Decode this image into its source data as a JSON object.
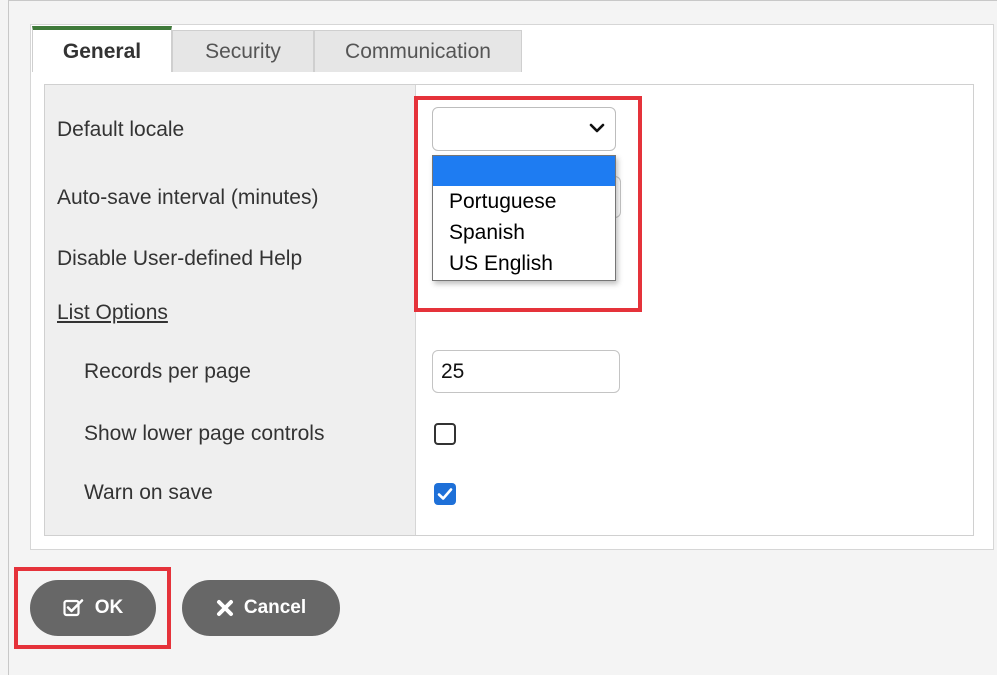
{
  "tabs": [
    {
      "label": "General",
      "active": true
    },
    {
      "label": "Security",
      "active": false
    },
    {
      "label": "Communication",
      "active": false
    }
  ],
  "form": {
    "default_locale_label": "Default locale",
    "autosave_label": "Auto-save interval (minutes)",
    "disable_help_label": "Disable User-defined Help",
    "list_options_label": "List Options",
    "records_per_page_label": "Records per page",
    "records_per_page_value": "25",
    "show_lower_controls_label": "Show lower page controls",
    "show_lower_controls_checked": false,
    "warn_on_save_label": "Warn on save",
    "warn_on_save_checked": true
  },
  "locale_dropdown": {
    "selected": "",
    "options": [
      "",
      "Portuguese",
      "Spanish",
      "US English"
    ]
  },
  "buttons": {
    "ok_label": "OK",
    "cancel_label": "Cancel"
  },
  "colors": {
    "active_tab_accent": "#3f7a3a",
    "highlight": "#e5323a",
    "selected_option": "#1e7cf2",
    "checkbox_checked": "#1e70d8",
    "button_bg": "#676767"
  }
}
